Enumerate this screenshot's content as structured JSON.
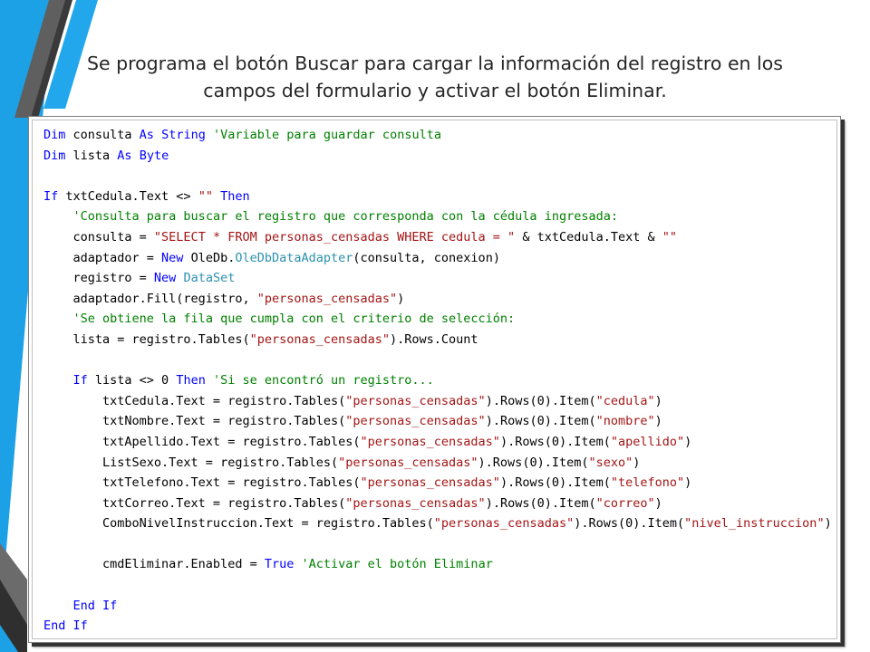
{
  "title": {
    "line1": "Se programa el botón Buscar para cargar la información del registro en los",
    "line2": "campos del formulario y activar el botón Eliminar."
  },
  "colors": {
    "keyword": "#0000ff",
    "type": "#2b91af",
    "string": "#a31515",
    "comment": "#008000",
    "decor_blue": "#1da1e6",
    "decor_gray": "#666666"
  },
  "code": {
    "lines": [
      [
        {
          "t": "kw",
          "v": "Dim"
        },
        {
          "t": "tx",
          "v": " consulta "
        },
        {
          "t": "kw",
          "v": "As"
        },
        {
          "t": "tx",
          "v": " "
        },
        {
          "t": "kw",
          "v": "String"
        },
        {
          "t": "tx",
          "v": " "
        },
        {
          "t": "cm",
          "v": "'Variable para guardar consulta"
        }
      ],
      [
        {
          "t": "kw",
          "v": "Dim"
        },
        {
          "t": "tx",
          "v": " lista "
        },
        {
          "t": "kw",
          "v": "As"
        },
        {
          "t": "tx",
          "v": " "
        },
        {
          "t": "kw",
          "v": "Byte"
        }
      ],
      [],
      [
        {
          "t": "kw",
          "v": "If"
        },
        {
          "t": "tx",
          "v": " txtCedula.Text <> "
        },
        {
          "t": "st",
          "v": "\"\""
        },
        {
          "t": "tx",
          "v": " "
        },
        {
          "t": "kw",
          "v": "Then"
        }
      ],
      [
        {
          "t": "tx",
          "v": "    "
        },
        {
          "t": "cm",
          "v": "'Consulta para buscar el registro que corresponda con la cédula ingresada:"
        }
      ],
      [
        {
          "t": "tx",
          "v": "    consulta = "
        },
        {
          "t": "st",
          "v": "\"SELECT * FROM personas_censadas WHERE cedula = \""
        },
        {
          "t": "tx",
          "v": " & txtCedula.Text & "
        },
        {
          "t": "st",
          "v": "\"\""
        }
      ],
      [
        {
          "t": "tx",
          "v": "    adaptador = "
        },
        {
          "t": "kw",
          "v": "New"
        },
        {
          "t": "tx",
          "v": " OleDb."
        },
        {
          "t": "ty",
          "v": "OleDbDataAdapter"
        },
        {
          "t": "tx",
          "v": "(consulta, conexion)"
        }
      ],
      [
        {
          "t": "tx",
          "v": "    registro = "
        },
        {
          "t": "kw",
          "v": "New"
        },
        {
          "t": "tx",
          "v": " "
        },
        {
          "t": "ty",
          "v": "DataSet"
        }
      ],
      [
        {
          "t": "tx",
          "v": "    adaptador.Fill(registro, "
        },
        {
          "t": "st",
          "v": "\"personas_censadas\""
        },
        {
          "t": "tx",
          "v": ")"
        }
      ],
      [
        {
          "t": "tx",
          "v": "    "
        },
        {
          "t": "cm",
          "v": "'Se obtiene la fila que cumpla con el criterio de selección:"
        }
      ],
      [
        {
          "t": "tx",
          "v": "    lista = registro.Tables("
        },
        {
          "t": "st",
          "v": "\"personas_censadas\""
        },
        {
          "t": "tx",
          "v": ").Rows.Count"
        }
      ],
      [],
      [
        {
          "t": "tx",
          "v": "    "
        },
        {
          "t": "kw",
          "v": "If"
        },
        {
          "t": "tx",
          "v": " lista <> 0 "
        },
        {
          "t": "kw",
          "v": "Then"
        },
        {
          "t": "tx",
          "v": " "
        },
        {
          "t": "cm",
          "v": "'Si se encontró un registro..."
        }
      ],
      [
        {
          "t": "tx",
          "v": "        txtCedula.Text = registro.Tables("
        },
        {
          "t": "st",
          "v": "\"personas_censadas\""
        },
        {
          "t": "tx",
          "v": ").Rows(0).Item("
        },
        {
          "t": "st",
          "v": "\"cedula\""
        },
        {
          "t": "tx",
          "v": ")"
        }
      ],
      [
        {
          "t": "tx",
          "v": "        txtNombre.Text = registro.Tables("
        },
        {
          "t": "st",
          "v": "\"personas_censadas\""
        },
        {
          "t": "tx",
          "v": ").Rows(0).Item("
        },
        {
          "t": "st",
          "v": "\"nombre\""
        },
        {
          "t": "tx",
          "v": ")"
        }
      ],
      [
        {
          "t": "tx",
          "v": "        txtApellido.Text = registro.Tables("
        },
        {
          "t": "st",
          "v": "\"personas_censadas\""
        },
        {
          "t": "tx",
          "v": ").Rows(0).Item("
        },
        {
          "t": "st",
          "v": "\"apellido\""
        },
        {
          "t": "tx",
          "v": ")"
        }
      ],
      [
        {
          "t": "tx",
          "v": "        ListSexo.Text = registro.Tables("
        },
        {
          "t": "st",
          "v": "\"personas_censadas\""
        },
        {
          "t": "tx",
          "v": ").Rows(0).Item("
        },
        {
          "t": "st",
          "v": "\"sexo\""
        },
        {
          "t": "tx",
          "v": ")"
        }
      ],
      [
        {
          "t": "tx",
          "v": "        txtTelefono.Text = registro.Tables("
        },
        {
          "t": "st",
          "v": "\"personas_censadas\""
        },
        {
          "t": "tx",
          "v": ").Rows(0).Item("
        },
        {
          "t": "st",
          "v": "\"telefono\""
        },
        {
          "t": "tx",
          "v": ")"
        }
      ],
      [
        {
          "t": "tx",
          "v": "        txtCorreo.Text = registro.Tables("
        },
        {
          "t": "st",
          "v": "\"personas_censadas\""
        },
        {
          "t": "tx",
          "v": ").Rows(0).Item("
        },
        {
          "t": "st",
          "v": "\"correo\""
        },
        {
          "t": "tx",
          "v": ")"
        }
      ],
      [
        {
          "t": "tx",
          "v": "        ComboNivelInstruccion.Text = registro.Tables("
        },
        {
          "t": "st",
          "v": "\"personas_censadas\""
        },
        {
          "t": "tx",
          "v": ").Rows(0).Item("
        },
        {
          "t": "st",
          "v": "\"nivel_instruccion\""
        },
        {
          "t": "tx",
          "v": ")"
        }
      ],
      [],
      [
        {
          "t": "tx",
          "v": "        cmdEliminar.Enabled = "
        },
        {
          "t": "kw",
          "v": "True"
        },
        {
          "t": "tx",
          "v": " "
        },
        {
          "t": "cm",
          "v": "'Activar el botón Eliminar"
        }
      ],
      [],
      [
        {
          "t": "tx",
          "v": "    "
        },
        {
          "t": "kw",
          "v": "End If"
        }
      ],
      [
        {
          "t": "kw",
          "v": "End If"
        }
      ]
    ]
  }
}
